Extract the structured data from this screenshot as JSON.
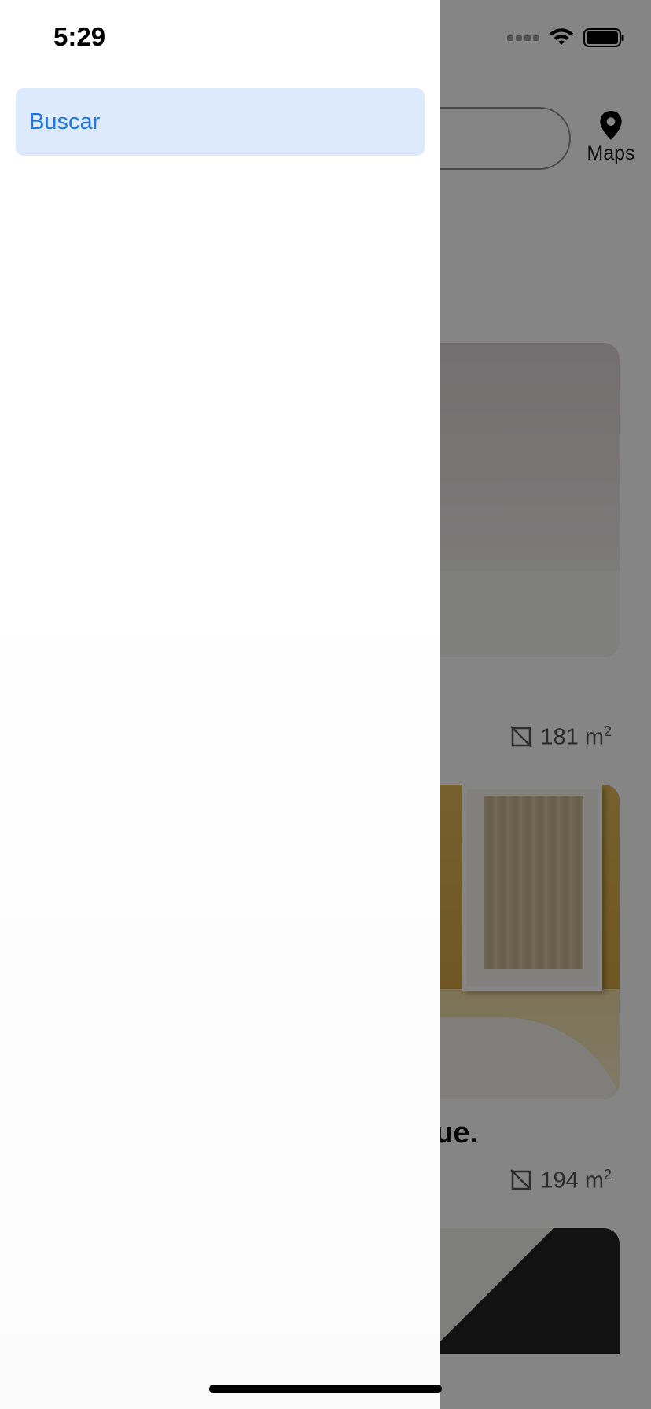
{
  "status_bar": {
    "time": "5:29",
    "icons": [
      "cellular-signal-icon",
      "wifi-icon",
      "battery-icon"
    ]
  },
  "drawer": {
    "items": [
      {
        "label": "Buscar",
        "selected": true
      }
    ],
    "colors": {
      "selected_bg": "#ddeafd",
      "selected_text": "#1e77e3"
    }
  },
  "main": {
    "header": {
      "maps_label": "Maps",
      "maps_icon": "map-pin-icon"
    },
    "listings": [
      {
        "area": "181 m",
        "area_unit_sup": "2",
        "area_icon": "area-icon"
      },
      {
        "title": "que.",
        "area": "194 m",
        "area_unit_sup": "2",
        "area_icon": "area-icon"
      }
    ],
    "overlay_color": "rgba(0,0,0,0.48)"
  }
}
